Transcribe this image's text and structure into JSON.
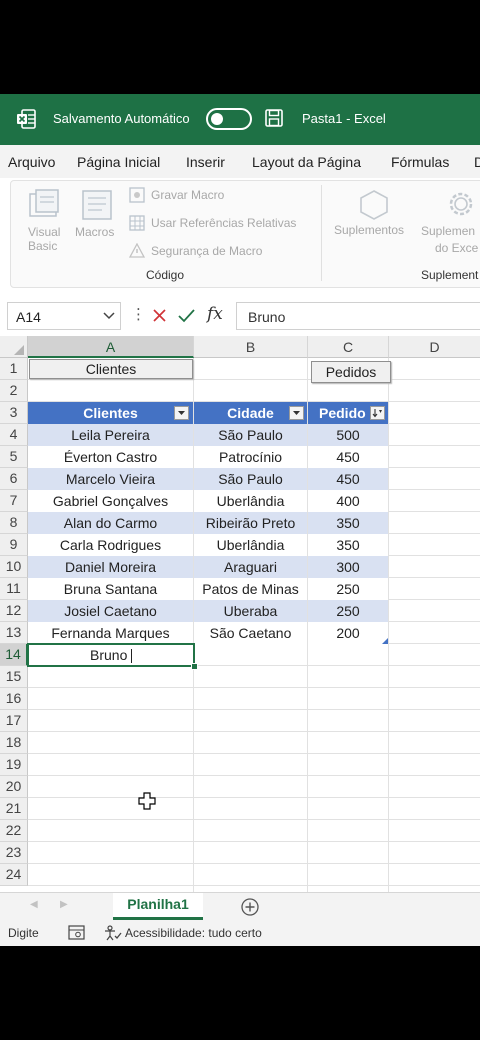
{
  "titlebar": {
    "autosave_label": "Salvamento Automático",
    "doc_title": "Pasta1  -  Excel"
  },
  "menu": [
    "Arquivo",
    "Página Inicial",
    "Inserir",
    "Layout da Página",
    "Fórmulas",
    "D"
  ],
  "ribbon": {
    "visual_basic": [
      "Visual",
      "Basic"
    ],
    "macros": "Macros",
    "record_macro": "Gravar Macro",
    "relative_refs": "Usar Referências Relativas",
    "macro_security": "Segurança de Macro",
    "group_code": "Código",
    "addins": "Suplementos",
    "excel_addins": [
      "Suplemen",
      "do Exce"
    ],
    "group_addins": "Suplement"
  },
  "formula_bar": {
    "name_box": "A14",
    "fx": "fx",
    "value": "Bruno"
  },
  "columns": [
    "A",
    "B",
    "C",
    "D"
  ],
  "rows": [
    "1",
    "2",
    "3",
    "4",
    "5",
    "6",
    "7",
    "8",
    "9",
    "10",
    "11",
    "12",
    "13",
    "14",
    "15",
    "16",
    "17",
    "18",
    "19",
    "20",
    "21",
    "22",
    "23",
    "24"
  ],
  "buttons": {
    "clientes": "Clientes",
    "pedidos": "Pedidos"
  },
  "table": {
    "headers": [
      "Clientes",
      "Cidade",
      "Pedido"
    ],
    "rows": [
      [
        "Leila Pereira",
        "São Paulo",
        "500"
      ],
      [
        "Éverton Castro",
        "Patrocínio",
        "450"
      ],
      [
        "Marcelo Vieira",
        "São Paulo",
        "450"
      ],
      [
        "Gabriel Gonçalves",
        "Uberlândia",
        "400"
      ],
      [
        "Alan do Carmo",
        "Ribeirão Preto",
        "350"
      ],
      [
        "Carla Rodrigues",
        "Uberlândia",
        "350"
      ],
      [
        "Daniel Moreira",
        "Araguari",
        "300"
      ],
      [
        "Bruna Santana",
        "Patos de Minas",
        "250"
      ],
      [
        "Josiel Caetano",
        "Uberaba",
        "250"
      ],
      [
        "Fernanda Marques",
        "São Caetano",
        "200"
      ]
    ]
  },
  "active_cell": {
    "ref": "A14",
    "value": "Bruno"
  },
  "sheet_tab": "Planilha1",
  "status": {
    "mode": "Digite",
    "accessibility": "Acessibilidade: tudo certo"
  },
  "colors": {
    "excel_green": "#1e7145",
    "table_header": "#4472c4",
    "table_band": "#d9e1f2"
  }
}
